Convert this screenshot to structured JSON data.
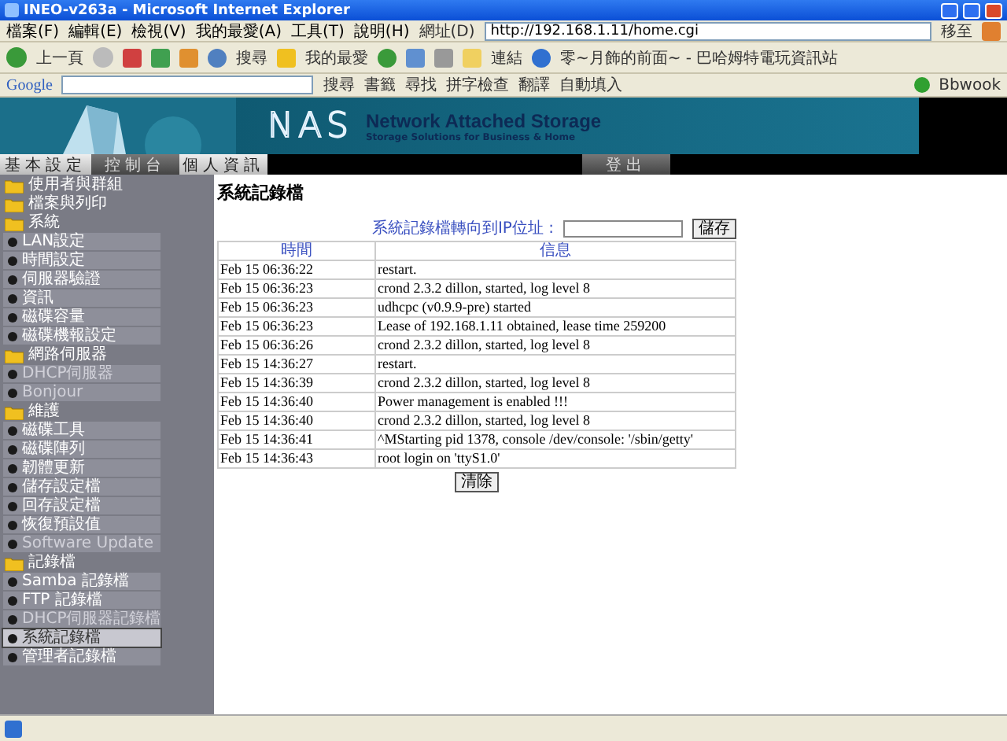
{
  "window": {
    "title": "INEO-v263a - Microsoft Internet Explorer"
  },
  "menu": [
    "檔案(F)",
    "編輯(E)",
    "檢視(V)",
    "我的最愛(A)",
    "工具(T)",
    "說明(H)"
  ],
  "address": {
    "label": "網址(D)",
    "value": "http://192.168.1.11/home.cgi",
    "go": "移至"
  },
  "toolbar": {
    "back": "上一頁",
    "search": "搜尋",
    "favorites": "我的最愛",
    "links_label": "連結",
    "link": "零~月飾的前面~ - 巴哈姆特電玩資訊站"
  },
  "google_bar": {
    "logo": "Google",
    "items": [
      "搜尋",
      "書籤",
      "尋找",
      "拼字檢查",
      "翻譯",
      "自動填入"
    ],
    "account": "Bbwook"
  },
  "banner": {
    "logo": "NAS",
    "title": "Network Attached Storage",
    "subtitle": "Storage Solutions for Business & Home"
  },
  "tabs": [
    {
      "label": "基本設定",
      "kind": "light"
    },
    {
      "label": "控制台",
      "kind": "dark"
    },
    {
      "label": "個人資訊",
      "kind": "light"
    },
    {
      "label": "登出",
      "kind": "dark"
    }
  ],
  "sidebar": [
    {
      "label": "使用者與群組"
    },
    {
      "label": "檔案與列印"
    },
    {
      "label": "系統",
      "children": [
        {
          "label": "LAN設定",
          "selected": false,
          "disabled": false
        },
        {
          "label": "時間設定",
          "selected": false,
          "disabled": false
        },
        {
          "label": "伺服器驗證",
          "selected": false,
          "disabled": false
        },
        {
          "label": "資訊",
          "selected": false,
          "disabled": false
        },
        {
          "label": "磁碟容量",
          "selected": false,
          "disabled": false
        },
        {
          "label": "磁碟機報設定",
          "selected": false,
          "disabled": false
        }
      ]
    },
    {
      "label": "網路伺服器",
      "children": [
        {
          "label": "DHCP伺服器",
          "selected": false,
          "disabled": true
        },
        {
          "label": "Bonjour",
          "selected": false,
          "disabled": true
        }
      ]
    },
    {
      "label": "維護",
      "children": [
        {
          "label": "磁碟工具",
          "selected": false,
          "disabled": false
        },
        {
          "label": "磁碟陣列",
          "selected": false,
          "disabled": false
        },
        {
          "label": "韌體更新",
          "selected": false,
          "disabled": false
        },
        {
          "label": "儲存設定檔",
          "selected": false,
          "disabled": false
        },
        {
          "label": "回存設定檔",
          "selected": false,
          "disabled": false
        },
        {
          "label": "恢復預設值",
          "selected": false,
          "disabled": false
        },
        {
          "label": "Software Update",
          "selected": false,
          "disabled": true
        }
      ]
    },
    {
      "label": "記錄檔",
      "children": [
        {
          "label": "Samba 記錄檔",
          "selected": false,
          "disabled": false
        },
        {
          "label": "FTP 記錄檔",
          "selected": false,
          "disabled": false
        },
        {
          "label": "DHCP伺服器記錄檔",
          "selected": false,
          "disabled": true
        },
        {
          "label": "系統記錄檔",
          "selected": true,
          "disabled": false
        },
        {
          "label": "管理者記錄檔",
          "selected": false,
          "disabled": false
        }
      ]
    }
  ],
  "page": {
    "title": "系統記錄檔",
    "redirect_label": "系統記錄檔轉向到IP位址 :",
    "save": "儲存",
    "clear": "清除"
  },
  "table": {
    "columns": [
      "時間",
      "信息"
    ],
    "rows": [
      [
        "Feb 15 06:36:22",
        "restart."
      ],
      [
        "Feb 15 06:36:23",
        "crond 2.3.2 dillon, started, log level 8"
      ],
      [
        "Feb 15 06:36:23",
        "udhcpc (v0.9.9-pre) started"
      ],
      [
        "Feb 15 06:36:23",
        "Lease of 192.168.1.11 obtained, lease time 259200"
      ],
      [
        "Feb 15 06:36:26",
        "crond 2.3.2 dillon, started, log level 8"
      ],
      [
        "Feb 15 14:36:27",
        "restart."
      ],
      [
        "Feb 15 14:36:39",
        "crond 2.3.2 dillon, started, log level 8"
      ],
      [
        "Feb 15 14:36:40",
        "Power management is enabled !!!"
      ],
      [
        "Feb 15 14:36:40",
        "crond 2.3.2 dillon, started, log level 8"
      ],
      [
        "Feb 15 14:36:41",
        "^MStarting pid 1378, console /dev/console: '/sbin/getty'"
      ],
      [
        "Feb 15 14:36:43",
        "root login on 'ttyS1.0'"
      ]
    ]
  }
}
